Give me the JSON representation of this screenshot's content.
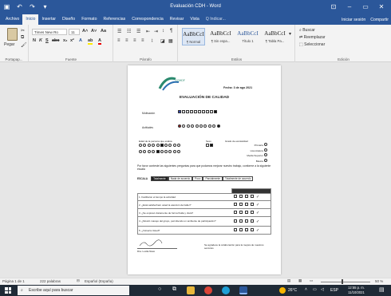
{
  "titlebar": {
    "doc_title": "Evaluación CDH - Word",
    "window_controls": [
      "⊡",
      "–",
      "▭",
      "✕"
    ]
  },
  "tabs": [
    "Archivo",
    "Inicio",
    "Insertar",
    "Diseño",
    "Formato",
    "Referencias",
    "Correspondencia",
    "Revisar",
    "Vista",
    "Q Indicar..."
  ],
  "tabs_right": [
    "Iniciar sesión",
    "Compartir"
  ],
  "ribbon": {
    "paste_label": "Pegar",
    "clipboard_label": "Portapap...",
    "font_name": "Times New Ro",
    "font_size": "11",
    "font_label": "Fuente",
    "paragraph_label": "Párrafo",
    "styles": [
      {
        "preview": "AaBbCcI",
        "name": "¶ Normal"
      },
      {
        "preview": "AaBbCcI",
        "name": "¶ Sin espa..."
      },
      {
        "preview": "AaBbCcI",
        "name": "Título 1"
      },
      {
        "preview": "AaBbCcI",
        "name": "¶ Tabla Pa..."
      }
    ],
    "styles_label": "Estilos",
    "edit_items": [
      "Buscar",
      "Reemplazar",
      "Seleccionar"
    ],
    "edit_label": "Edición"
  },
  "document": {
    "logo_text": "CDHDF",
    "date": "Fecha: 3 de ago 2021",
    "heading": "EVALUACIÓN DE CALIDAD",
    "row1_label": "Motivación",
    "row2_label": "Actitudes",
    "pill_labels": [
      "Edad de la persona que evalúa",
      "Sexo",
      "Grado de escolaridad"
    ],
    "education_options": [
      "Primaria",
      "Licenciatura",
      "Media Superior",
      "Básica"
    ],
    "instructions": "Por favor conteste las siguientes preguntas para que podamos mejorar nuestro trabajo, conforme a la siguiente escala",
    "scale_label": "ESCALA",
    "scale_items": [
      "Totalmente",
      "Nada de acuerdo",
      "Poco",
      "Parcialmente",
      "Totalmente de acuerdo"
    ],
    "questions": [
      "1. Facilitaron el tiempo la actividad",
      "2. ¿Está satisfecha/o usted la atención del taller?",
      "3. ¿Se expresó claramente de forma fluida y clara?",
      "4. ¿Mostró manejo del grupo, permitiendo un ambiente de participación?",
      "5. ¿Volvería Usted?"
    ],
    "footer_left": "Dra. Lucila Nieto",
    "footer_right": "Se agradece la colaboración para la mejora de nuestros servicios"
  },
  "statusbar": {
    "page": "Página 1 de 1",
    "words": "222 palabras",
    "language": "Español (España)",
    "zoom": "50 %"
  },
  "taskbar": {
    "search_placeholder": "Escribe aquí para buscar",
    "weather": "26°C",
    "lang": "ESP",
    "time": "12:55 p. m.",
    "date": "11/10/2021"
  },
  "colors": {
    "accent": "#2b579a",
    "taskbar": "#1f2a36"
  }
}
